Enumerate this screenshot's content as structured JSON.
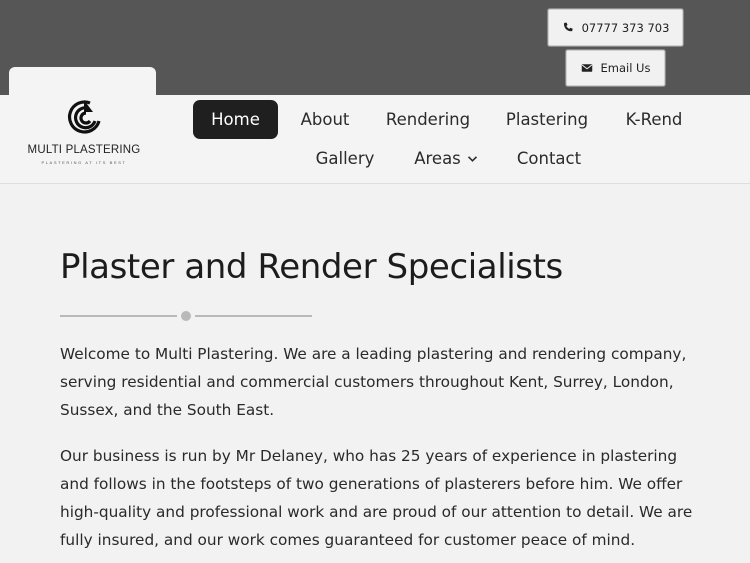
{
  "topbar": {
    "phone": {
      "label": "07777 373 703",
      "icon": "phone-icon"
    },
    "email": {
      "label": "Email Us",
      "icon": "envelope-icon"
    }
  },
  "logo": {
    "name": "MULTI PLASTERING",
    "tagline": "PLASTERING AT ITS BEST"
  },
  "nav": {
    "items": [
      {
        "label": "Home",
        "active": true
      },
      {
        "label": "About"
      },
      {
        "label": "Rendering"
      },
      {
        "label": "Plastering"
      },
      {
        "label": "K-Rend"
      },
      {
        "label": "Gallery"
      },
      {
        "label": "Areas",
        "has_dropdown": true
      },
      {
        "label": "Contact"
      }
    ]
  },
  "main": {
    "title": "Plaster and Render Specialists",
    "paragraphs": [
      "Welcome to Multi Plastering. We are a leading plastering and rendering company, serving residential and commercial customers throughout Kent, Surrey, London, Sussex, and the South East.",
      "Our business is run by Mr Delaney, who has 25 years of experience in plastering and follows in the footsteps of two generations of plasterers before him. We offer high-quality and professional work and are proud of our attention to detail. We are fully insured, and our work comes guaranteed for customer peace of mind."
    ]
  },
  "colors": {
    "topbar": "#565656",
    "header": "#f4f4f4",
    "active_nav": "#1f1f1f",
    "divider": "#b9b9b9"
  }
}
